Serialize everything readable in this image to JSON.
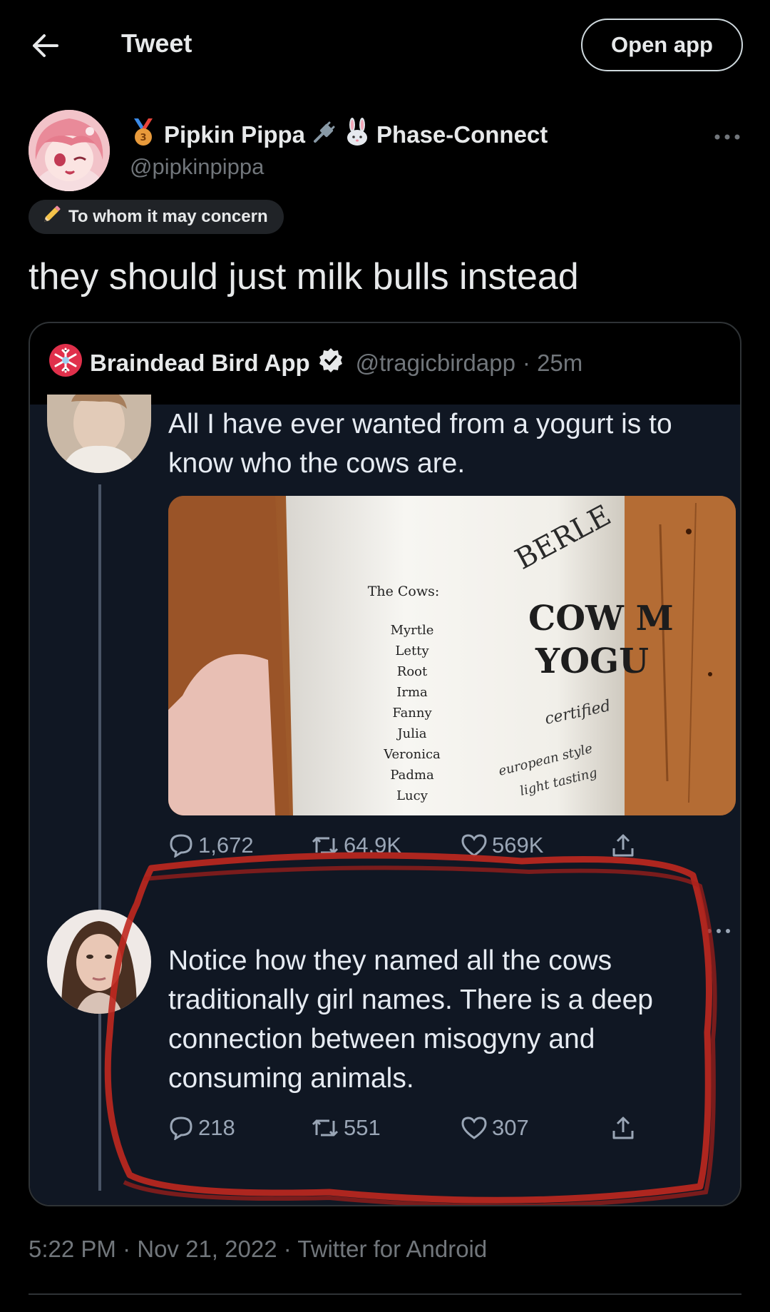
{
  "header": {
    "title": "Tweet",
    "open_app_label": "Open app"
  },
  "author": {
    "name": "Pipkin Pippa",
    "affiliation": "Phase-Connect",
    "handle": "@pipkinpippa"
  },
  "label": {
    "text": "To whom it may concern"
  },
  "tweet": {
    "text": "they should just milk bulls instead"
  },
  "quoted": {
    "name": "Braindead Bird App",
    "handle": "@tragicbirdapp",
    "age": "· 25m",
    "screenshot": {
      "post1": {
        "text_line1": "All I have ever wanted from a yogurt is to",
        "text_line2": "know who the cows are.",
        "image": {
          "cows_title": "The Cows:",
          "cow_names": [
            "Myrtle",
            "Letty",
            "Root",
            "Irma",
            "Fanny",
            "Julia",
            "Veronica",
            "Padma",
            "Lucy"
          ],
          "brand": "BERLE",
          "product_line1": "COW M",
          "product_line2": "YOGU",
          "small1": "certified",
          "small2": "european style",
          "small3": "light tasting"
        },
        "replies": "1,672",
        "retweets": "64.9K",
        "likes": "569K"
      },
      "post2": {
        "text_line1": "Notice how they named all the cows",
        "text_line2": "traditionally girl names. There is a deep",
        "text_line3": "connection between misogyny and",
        "text_line4": "consuming animals.",
        "replies": "218",
        "retweets": "551",
        "likes": "307"
      }
    }
  },
  "meta": {
    "time": "5:22 PM",
    "date": "Nov 21, 2022",
    "source": "Twitter for Android",
    "separator": " · "
  },
  "colors": {
    "background": "#000000",
    "text": "#e7e9ea",
    "muted": "#71767b",
    "border": "#2f3336",
    "verified": "#e7e9ea",
    "annotation_red": "#c0281f"
  }
}
